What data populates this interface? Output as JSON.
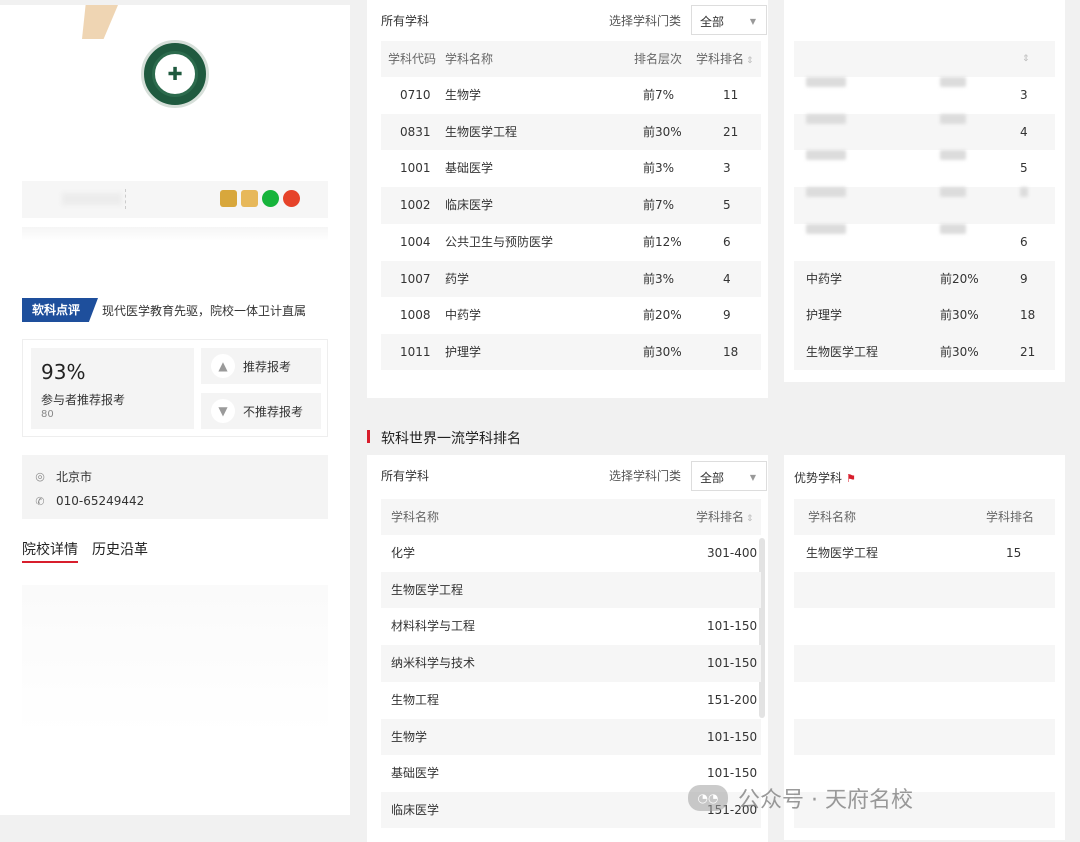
{
  "profile": {
    "review_tag": "软科点评",
    "review_text": "现代医学教育先驱，院校一体卫计直属",
    "recommend_percent": "93%",
    "recommend_label": "参与者推荐报考",
    "recommend_count": "80",
    "recommend_button": "推荐报考",
    "not_recommend_button": "不推荐报考",
    "city": "北京市",
    "phone": "010-65249442",
    "tabs": [
      "院校详情",
      "历史沿革"
    ]
  },
  "ranking": {
    "title": "所有学科",
    "select_label": "选择学科门类",
    "select_value": "全部",
    "headers": {
      "code": "学科代码",
      "name": "学科名称",
      "level": "排名层次",
      "rank": "学科排名"
    },
    "rows": [
      {
        "code": "0710",
        "name": "生物学",
        "level": "前7%",
        "rank": "11"
      },
      {
        "code": "0831",
        "name": "生物医学工程",
        "level": "前30%",
        "rank": "21"
      },
      {
        "code": "1001",
        "name": "基础医学",
        "level": "前3%",
        "rank": "3"
      },
      {
        "code": "1002",
        "name": "临床医学",
        "level": "前7%",
        "rank": "5"
      },
      {
        "code": "1004",
        "name": "公共卫生与预防医学",
        "level": "前12%",
        "rank": "6"
      },
      {
        "code": "1007",
        "name": "药学",
        "level": "前3%",
        "rank": "4"
      },
      {
        "code": "1008",
        "name": "中药学",
        "level": "前20%",
        "rank": "9"
      },
      {
        "code": "1011",
        "name": "护理学",
        "level": "前30%",
        "rank": "18"
      }
    ]
  },
  "side_ranking": {
    "rows": [
      {
        "name": "",
        "level": "",
        "rank": "3"
      },
      {
        "name": "",
        "level": "",
        "rank": "4"
      },
      {
        "name": "",
        "level": "",
        "rank": "5"
      },
      {
        "name": "",
        "level": "",
        "rank": ""
      },
      {
        "name": "",
        "level": "",
        "rank": "6"
      },
      {
        "name": "中药学",
        "level": "前20%",
        "rank": "9"
      },
      {
        "name": "护理学",
        "level": "前30%",
        "rank": "18"
      },
      {
        "name": "生物医学工程",
        "level": "前30%",
        "rank": "21"
      }
    ]
  },
  "world": {
    "section_title": "软科世界一流学科排名",
    "title": "所有学科",
    "select_label": "选择学科门类",
    "select_value": "全部",
    "headers": {
      "name": "学科名称",
      "rank": "学科排名"
    },
    "rows": [
      {
        "name": "化学",
        "rank": "301-400"
      },
      {
        "name": "生物医学工程",
        "rank": ""
      },
      {
        "name": "材料科学与工程",
        "rank": "101-150"
      },
      {
        "name": "纳米科学与技术",
        "rank": "101-150"
      },
      {
        "name": "生物工程",
        "rank": "151-200"
      },
      {
        "name": "生物学",
        "rank": "101-150"
      },
      {
        "name": "基础医学",
        "rank": "101-150"
      },
      {
        "name": "临床医学",
        "rank": "151-200"
      }
    ]
  },
  "advantage": {
    "title": "优势学科",
    "headers": {
      "name": "学科名称",
      "rank": "学科排名"
    },
    "rows": [
      {
        "name": "生物医学工程",
        "rank": "15"
      }
    ]
  },
  "watermark": "公众号 · 天府名校"
}
